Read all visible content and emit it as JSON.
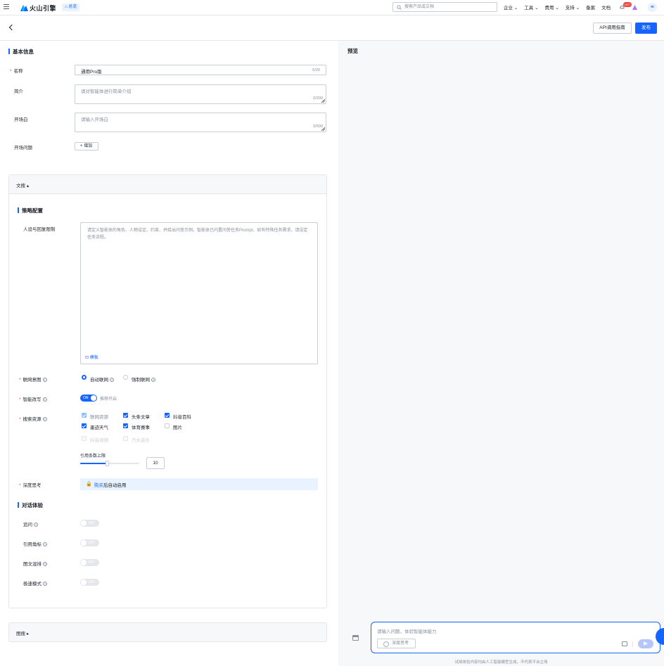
{
  "nav": {
    "brand": "火山引擎",
    "home_label": "总览",
    "search_placeholder": "搜索产品或文档",
    "links": [
      "企业",
      "工具",
      "费用",
      "支持",
      "备案",
      "文档"
    ],
    "hot_badge": "HOT",
    "avatar_initials": "m"
  },
  "toolbar": {
    "api_guide": "API调用指南",
    "publish": "发布"
  },
  "basic": {
    "title": "基本信息",
    "name_label": "名称",
    "name_value": "通用Pro版",
    "name_counter": "6/20",
    "intro_label": "简介",
    "intro_placeholder": "请对智能体进行简单介绍",
    "intro_counter": "0/200",
    "opening_label": "开场白",
    "opening_placeholder": "请输入开场白",
    "opening_counter": "0/500",
    "questions_label": "开场问题",
    "add_label": "增加"
  },
  "wensou": {
    "header": "文搜",
    "strategy_title": "策略配置",
    "persona_label": "人设与回复限制",
    "persona_placeholder": "请定义智能体的角色、人物设定、约束、并给出问答示例。智能体已内置问答任务Prompt，如有特殊任务需求，请设定任务流程。",
    "template_label": "模板",
    "intent_label": "联网意图",
    "intent_options": [
      "自动联网",
      "强制联网"
    ],
    "rewrite_label": "智能改写",
    "rewrite_toggle": "ON",
    "rewrite_hint": "推荐开启",
    "sources_label": "搜索资源",
    "sources": [
      "联网资源",
      "头条文章",
      "抖音百科",
      "墨迹天气",
      "体育赛事",
      "图片",
      "抖音视频",
      "汽水音乐"
    ],
    "ref_limit_label": "引用条数上限",
    "ref_limit_value": "10",
    "deep_label": "深度思考",
    "deep_buy": "购买",
    "deep_suffix": "后自动启用",
    "dialog_title": "对话体验",
    "followup_label": "追问",
    "citation_label": "引用角标",
    "mixed_label": "图文混排",
    "fast_label": "极速模式",
    "off": "OFF"
  },
  "tusou": {
    "header": "图搜"
  },
  "preview": {
    "title": "预览",
    "input_placeholder": "请输入问题，体验智能体能力",
    "deep_button": "深度思考",
    "disclaimer": "试用体验内容均由人工智能模型生成，不代表平台立场"
  },
  "colors": {
    "primary": "#1664ff",
    "required": "#f53f3f"
  },
  "settings": {
    "ref_limit_fraction": 0.45
  }
}
